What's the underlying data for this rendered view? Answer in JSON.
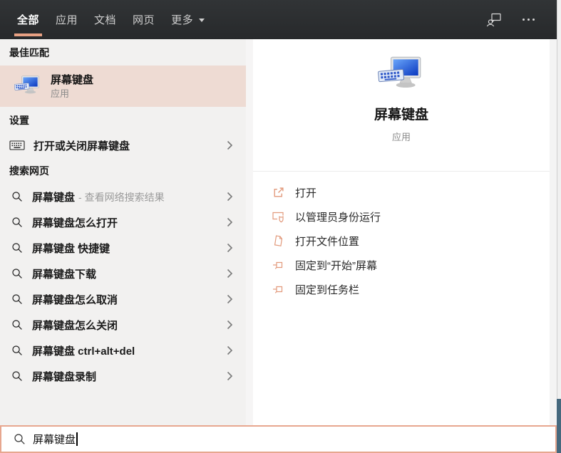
{
  "header": {
    "tabs": [
      {
        "label": "全部"
      },
      {
        "label": "应用"
      },
      {
        "label": "文档"
      },
      {
        "label": "网页"
      },
      {
        "label": "更多"
      }
    ]
  },
  "left_panel": {
    "best_match_header": "最佳匹配",
    "best_match": {
      "title": "屏幕键盘",
      "subtitle": "应用"
    },
    "settings_header": "设置",
    "settings_item": {
      "label": "打开或关闭屏幕键盘"
    },
    "web_header": "搜索网页",
    "suggestions": [
      {
        "text": "屏幕键盘",
        "suffix": "- 查看网络搜索结果"
      },
      {
        "text": "屏幕键盘怎么打开"
      },
      {
        "text": "屏幕键盘 快捷键"
      },
      {
        "text": "屏幕键盘下载"
      },
      {
        "text": "屏幕键盘怎么取消"
      },
      {
        "text": "屏幕键盘怎么关闭"
      },
      {
        "text": "屏幕键盘 ctrl+alt+del"
      },
      {
        "text": "屏幕键盘录制"
      }
    ]
  },
  "detail_panel": {
    "app_title": "屏幕键盘",
    "app_type": "应用",
    "actions": [
      {
        "label": "打开",
        "icon": "open-icon"
      },
      {
        "label": "以管理员身份运行",
        "icon": "run-as-admin-icon"
      },
      {
        "label": "打开文件位置",
        "icon": "open-file-location-icon"
      },
      {
        "label": "固定到“开始”屏幕",
        "icon": "pin-to-start-icon"
      },
      {
        "label": "固定到任务栏",
        "icon": "pin-to-taskbar-icon"
      }
    ]
  },
  "search_box": {
    "value": "屏幕键盘"
  },
  "colors": {
    "accent_salmon": "#e8a183",
    "best_match_highlight": "#eedbd3",
    "header_bg": "#2b2e30",
    "search_border": "#e7a78f",
    "teal_desktop": "#46697e"
  }
}
